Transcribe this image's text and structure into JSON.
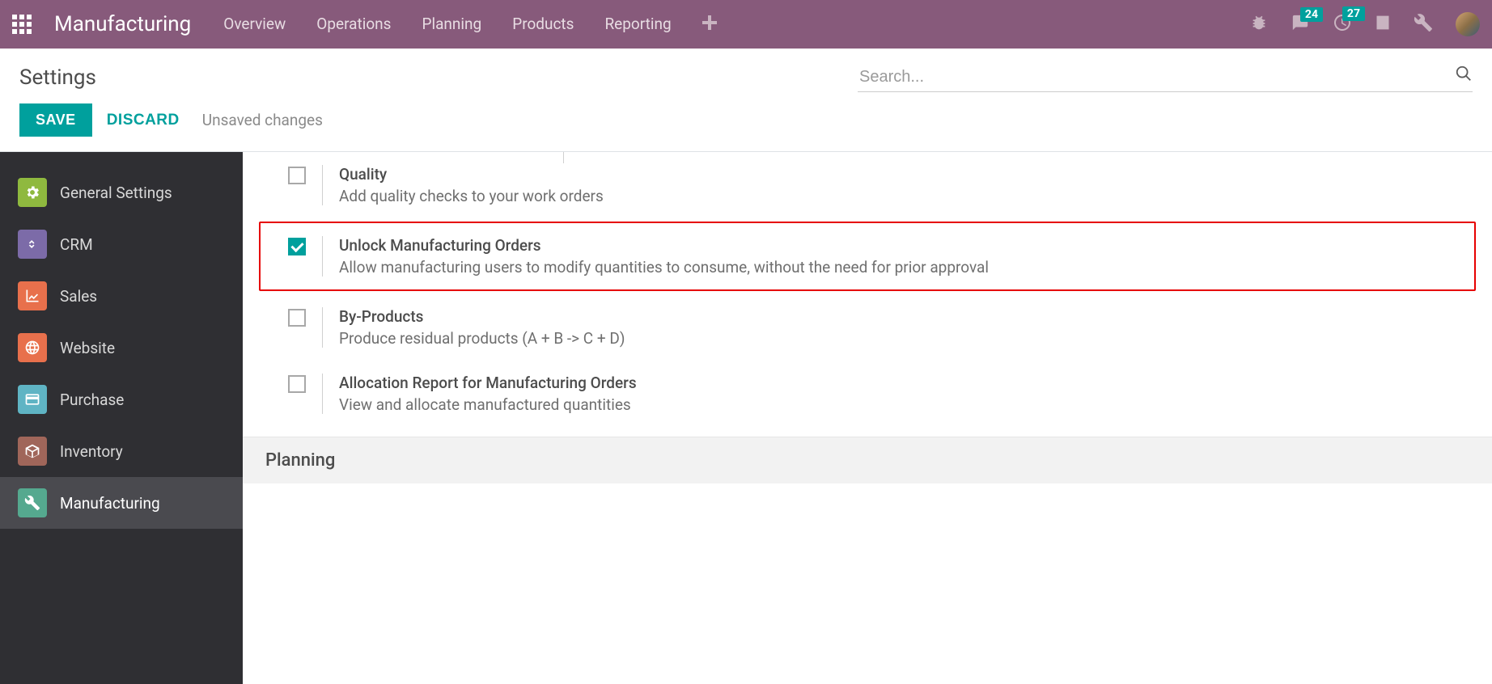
{
  "topbar": {
    "brand": "Manufacturing",
    "nav": [
      "Overview",
      "Operations",
      "Planning",
      "Products",
      "Reporting"
    ],
    "chat_badge": "24",
    "activity_badge": "27"
  },
  "page": {
    "title": "Settings",
    "search_placeholder": "Search...",
    "save_label": "SAVE",
    "discard_label": "DISCARD",
    "unsaved_label": "Unsaved changes"
  },
  "sidebar": {
    "items": [
      {
        "label": "General Settings"
      },
      {
        "label": "CRM"
      },
      {
        "label": "Sales"
      },
      {
        "label": "Website"
      },
      {
        "label": "Purchase"
      },
      {
        "label": "Inventory"
      },
      {
        "label": "Manufacturing"
      }
    ]
  },
  "settings": [
    {
      "checked": false,
      "title": "Quality",
      "desc": "Add quality checks to your work orders",
      "highlight": false
    },
    {
      "checked": true,
      "title": "Unlock Manufacturing Orders",
      "desc": "Allow manufacturing users to modify quantities to consume, without the need for prior approval",
      "highlight": true
    },
    {
      "checked": false,
      "title": "By-Products",
      "desc": "Produce residual products (A + B -> C + D)",
      "highlight": false
    },
    {
      "checked": false,
      "title": "Allocation Report for Manufacturing Orders",
      "desc": "View and allocate manufactured quantities",
      "highlight": false
    }
  ],
  "section": {
    "planning": "Planning"
  }
}
